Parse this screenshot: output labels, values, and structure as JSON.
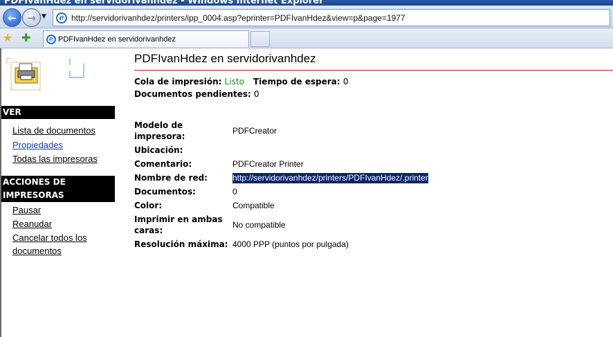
{
  "window": {
    "title": "PDFIvanHdez en servidorivanhdez - Windows Internet Explorer"
  },
  "browser": {
    "address": "http://servidorivanhdez/printers/ipp_0004.asp?eprinter=PDFIvanHdez&view=p&page=1977",
    "tab_title": "PDFIvanHdez en servidorivanhdez"
  },
  "sidebar": {
    "sections": [
      {
        "title": "VER",
        "links": [
          "Lista de documentos",
          "Propiedades",
          "Todas las impresoras"
        ]
      },
      {
        "title_line1": "ACCIONES DE",
        "title_line2": "IMPRESORAS",
        "links": [
          "Pausar",
          "Reanudar",
          "Cancelar todos los",
          "documentos"
        ]
      }
    ]
  },
  "main": {
    "title": "PDFIvanHdez en servidorivanhdez",
    "status": {
      "queue_label": "Cola de impresión:",
      "queue_value": "Listo",
      "wait_label": "Tiempo de espera:",
      "wait_value": "0",
      "pending_label": "Documentos pendientes:",
      "pending_value": "0"
    },
    "properties": [
      {
        "label1": "Modelo de",
        "label2": "impresora:",
        "value": "PDFCreator"
      },
      {
        "label": "Ubicación:",
        "value": ""
      },
      {
        "label": "Comentario:",
        "value": "PDFCreator Printer"
      },
      {
        "label": "Nombre de red:",
        "value": "http://servidorivanhdez/printers/PDFIvanHdez/.printer"
      },
      {
        "label": "Documentos:",
        "value": "0"
      },
      {
        "label": "Color:",
        "value": "Compatible"
      },
      {
        "label1": "Imprimir en ambas",
        "label2": "caras:",
        "value": "No compatible"
      },
      {
        "label": "Resolución máxima:",
        "value": "4000 PPP (puntos por pulgada)"
      }
    ]
  }
}
